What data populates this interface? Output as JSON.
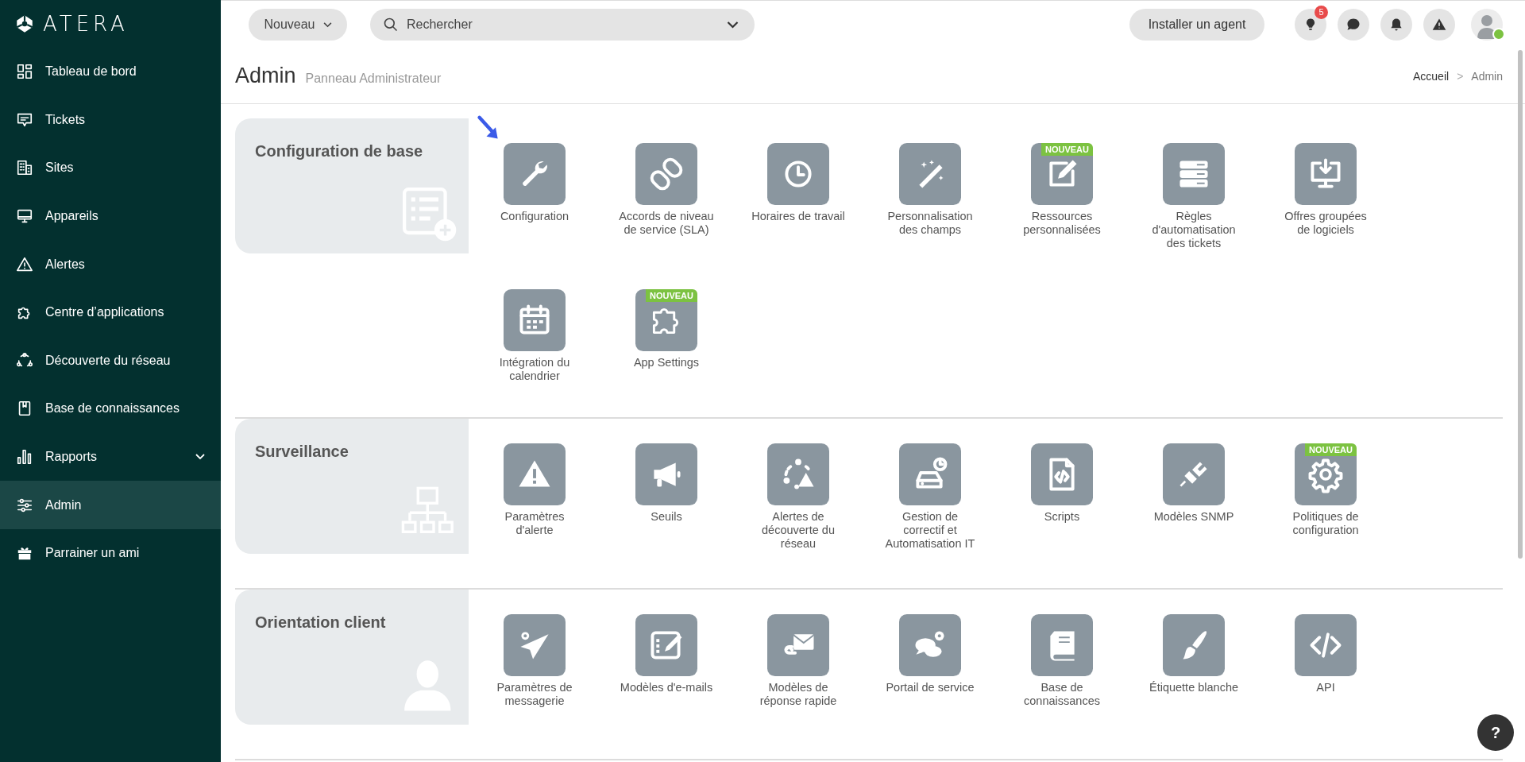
{
  "sidebar": {
    "brand": "ATERA",
    "items": [
      {
        "label": "Tableau de bord",
        "selected": false,
        "expandable": false
      },
      {
        "label": "Tickets",
        "selected": false,
        "expandable": false
      },
      {
        "label": "Sites",
        "selected": false,
        "expandable": false
      },
      {
        "label": "Appareils",
        "selected": false,
        "expandable": false
      },
      {
        "label": "Alertes",
        "selected": false,
        "expandable": false
      },
      {
        "label": "Centre d’applications",
        "selected": false,
        "expandable": false
      },
      {
        "label": "Découverte du réseau",
        "selected": false,
        "expandable": false
      },
      {
        "label": "Base de connaissances",
        "selected": false,
        "expandable": false
      },
      {
        "label": "Rapports",
        "selected": false,
        "expandable": true
      },
      {
        "label": "Admin",
        "selected": true,
        "expandable": false
      },
      {
        "label": "Parrainer un ami",
        "selected": false,
        "expandable": false
      }
    ]
  },
  "header": {
    "new_button": "Nouveau",
    "search": {
      "placeholder": "Rechercher"
    },
    "install_button": "Installer un agent",
    "tips_badge": "5"
  },
  "page": {
    "title": "Admin",
    "subtitle": "Panneau Administrateur",
    "breadcrumb": {
      "items": [
        "Accueil",
        "Admin"
      ],
      "separator": ">"
    }
  },
  "sections": [
    {
      "title": "Configuration de base",
      "tiles": [
        {
          "label": "Configuration",
          "highlighted": true
        },
        {
          "label": "Accords de niveau de service (SLA)",
          "highlighted": false
        },
        {
          "label": "Horaires de travail",
          "highlighted": false
        },
        {
          "label": "Personnalisation des champs",
          "highlighted": false
        },
        {
          "label": "Ressources personnalisées",
          "badge": "NOUVEAU",
          "highlighted": false
        },
        {
          "label": "Règles d'automatisation des tickets",
          "highlighted": false
        },
        {
          "label": "Offres groupées de logiciels",
          "highlighted": false
        },
        {
          "label": "Intégration du calendrier",
          "highlighted": false
        },
        {
          "label": "App Settings",
          "badge": "NOUVEAU",
          "highlighted": false
        }
      ]
    },
    {
      "title": "Surveillance",
      "tiles": [
        {
          "label": "Paramètres d'alerte",
          "highlighted": false
        },
        {
          "label": "Seuils",
          "highlighted": false
        },
        {
          "label": "Alertes de découverte du réseau",
          "highlighted": false
        },
        {
          "label": "Gestion de correctif et Automatisation IT",
          "highlighted": false
        },
        {
          "label": "Scripts",
          "highlighted": false
        },
        {
          "label": "Modèles SNMP",
          "highlighted": false
        },
        {
          "label": "Politiques de configuration",
          "badge": "NOUVEAU",
          "highlighted": false
        }
      ]
    },
    {
      "title": "Orientation client",
      "tiles": [
        {
          "label": "Paramètres de messagerie",
          "highlighted": false
        },
        {
          "label": "Modèles d'e-mails",
          "highlighted": false
        },
        {
          "label": "Modèles de réponse rapide",
          "highlighted": false
        },
        {
          "label": "Portail de service",
          "highlighted": false
        },
        {
          "label": "Base de connaissances",
          "highlighted": false
        },
        {
          "label": "Étiquette blanche",
          "highlighted": false
        },
        {
          "label": "API",
          "highlighted": false
        }
      ]
    }
  ],
  "help_button": "?"
}
